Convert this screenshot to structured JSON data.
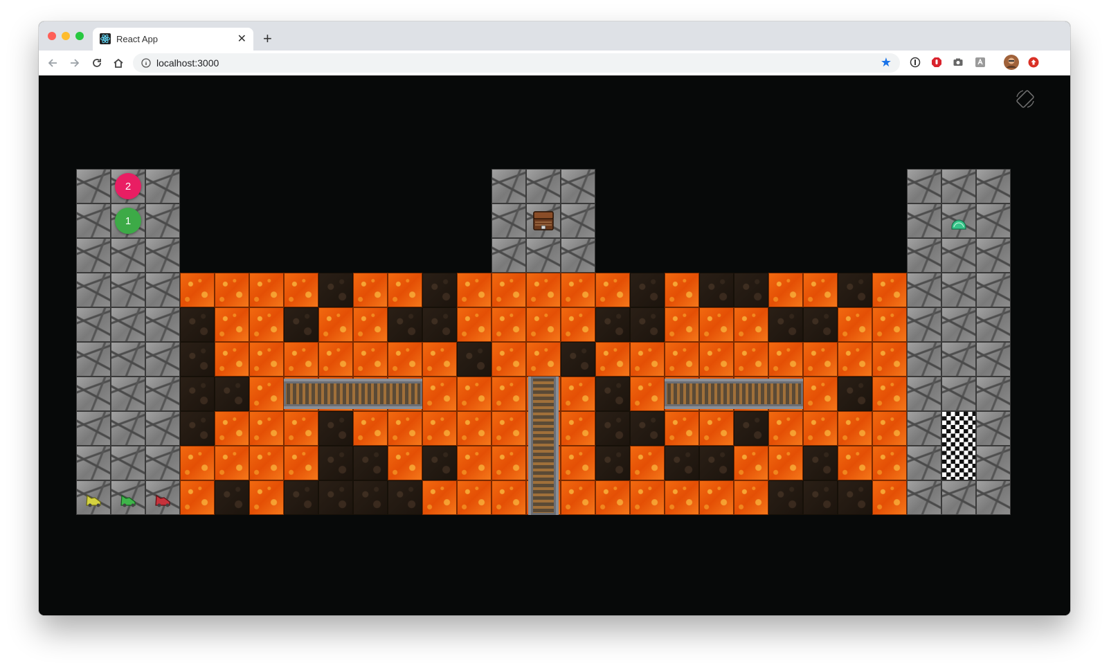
{
  "browser": {
    "tab_title": "React App",
    "url": "localhost:3000"
  },
  "game": {
    "players": [
      {
        "number": "2",
        "color": "#e91e63"
      },
      {
        "number": "1",
        "color": "#3daa47"
      }
    ],
    "cars": [
      {
        "color": "yellow",
        "hex": "#d4d240"
      },
      {
        "color": "green",
        "hex": "#3fb54a"
      },
      {
        "color": "red",
        "hex": "#c6323b"
      }
    ],
    "items": [
      "treasure-chest",
      "emerald-gem",
      "checkered-finish"
    ],
    "lava_grid": [
      "LLLLDLLDLLLLLDLDDLLD",
      "DLLDLLDDLLLLDDLLLDDLL",
      "DLLLLLLLDLLDLLLLLLLL",
      "DDLLLLLLLLLLDLLLLLLD",
      "DLLLDLLLLLLLDDLLDLLL",
      "LLLLDDLDLLLLDLDDLLDL",
      "LDLDDDDLLLLLLLLLLDDD"
    ]
  }
}
